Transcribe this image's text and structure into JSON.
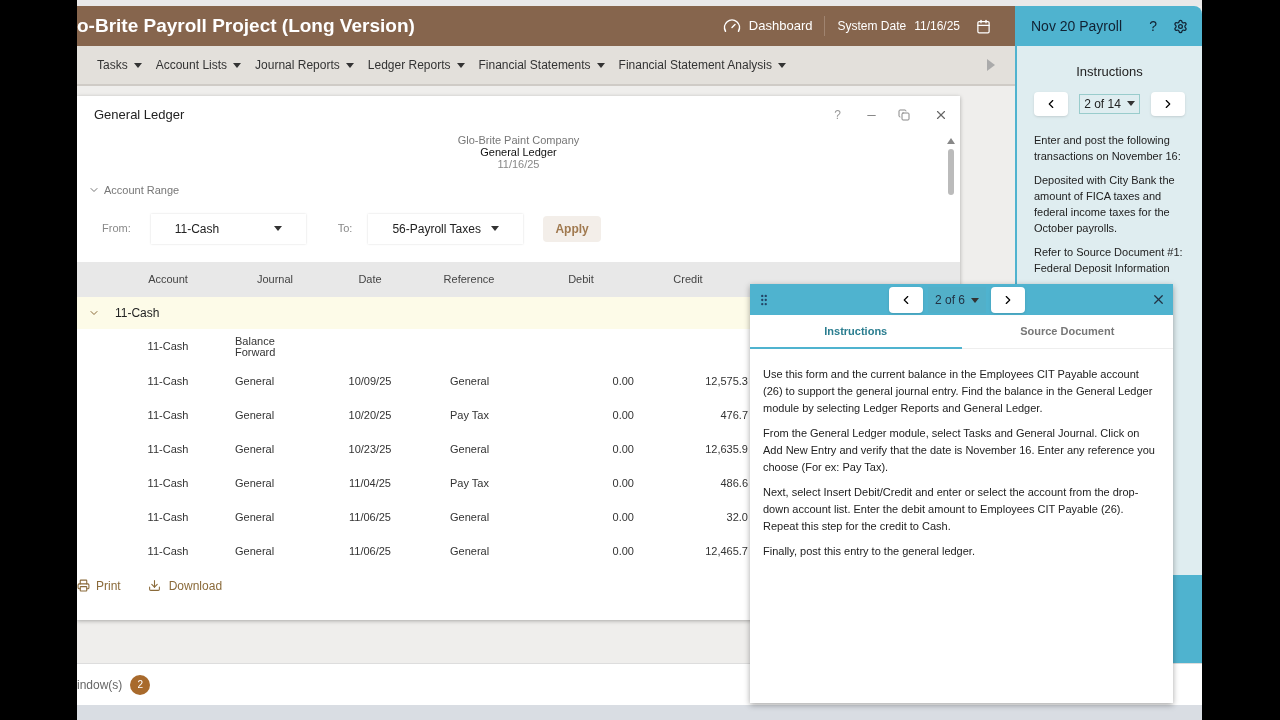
{
  "header": {
    "title": "o-Brite Payroll Project (Long Version)",
    "dashboard": "Dashboard",
    "system_date_label": "System Date",
    "system_date": "11/16/25"
  },
  "menu": [
    "Tasks",
    "Account Lists",
    "Journal Reports",
    "Ledger Reports",
    "Financial Statements",
    "Financial Statement Analysis"
  ],
  "ledger_window": {
    "title": "General Ledger",
    "help": "?",
    "company": "Glo-Brite Paint Company",
    "report": "General Ledger",
    "date": "11/16/25",
    "account_range": {
      "label": "Account Range",
      "expanded": true,
      "from_label": "From:",
      "from": "11-Cash",
      "to_label": "To:",
      "to": "56-Payroll Taxes",
      "apply": "Apply"
    },
    "columns": [
      "Account",
      "Journal",
      "Date",
      "Reference",
      "Debit",
      "Credit"
    ],
    "group": {
      "name": "11-Cash",
      "expanded": true
    },
    "rows": [
      [
        "11-Cash",
        "Balance\nForward",
        "",
        "",
        "",
        ""
      ],
      [
        "11-Cash",
        "General",
        "10/09/25",
        "General",
        "0.00",
        "12,575.3"
      ],
      [
        "11-Cash",
        "General",
        "10/20/25",
        "Pay Tax",
        "0.00",
        "476.7"
      ],
      [
        "11-Cash",
        "General",
        "10/23/25",
        "General",
        "0.00",
        "12,635.9"
      ],
      [
        "11-Cash",
        "General",
        "11/04/25",
        "Pay Tax",
        "0.00",
        "486.6"
      ],
      [
        "11-Cash",
        "General",
        "11/06/25",
        "General",
        "0.00",
        "32.0"
      ],
      [
        "11-Cash",
        "General",
        "11/06/25",
        "General",
        "0.00",
        "12,465.7"
      ]
    ],
    "print": "Print",
    "download": "Download"
  },
  "footer": {
    "windows": "indow(s)",
    "count": "2"
  },
  "side_panel": {
    "title": "Nov 20 Payroll",
    "help": "?",
    "heading": "Instructions",
    "pager": "2 of 14",
    "paragraphs": [
      "Enter and post the following transactions on November 16:",
      "Deposited with City Bank the amount of FICA taxes and federal income taxes for the October payrolls.",
      "Refer to Source Document #1: Federal Deposit Information"
    ]
  },
  "float_panel": {
    "pager": "2 of 6",
    "tabs": [
      {
        "label": "Instructions",
        "selected": true
      },
      {
        "label": "Source Document",
        "selected": false
      }
    ],
    "paragraphs": [
      "Use this form and the current balance in the Employees CIT Payable account (26) to support the general journal entry. Find the balance in the General Ledger module by selecting Ledger Reports and General Ledger.",
      "From the General Ledger module, select Tasks and General Journal. Click on Add New Entry and verify that the date is November 16. Enter any reference you choose (For ex: Pay Tax).",
      "Next, select Insert Debit/Credit and enter or select the account from the drop-down account list. Enter the debit amount to Employees CIT Payable (26). Repeat this step for the credit to Cash.",
      "Finally, post this entry to the general ledger."
    ]
  }
}
